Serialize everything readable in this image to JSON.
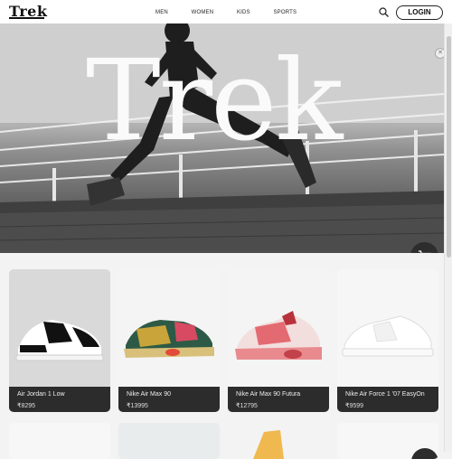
{
  "header": {
    "logo": "Trek",
    "menu": [
      "MEN",
      "WOMEN",
      "KIDS",
      "SPORTS"
    ],
    "login_label": "LOGIN"
  },
  "hero": {
    "title": "Trek"
  },
  "products": [
    {
      "name": "Air Jordan 1 Low",
      "price": "₹8295"
    },
    {
      "name": "Nike Air Max 90",
      "price": "₹13995"
    },
    {
      "name": "Nike Air Max 90 Futura",
      "price": "₹12795"
    },
    {
      "name": "Nike Air Force 1 '07 EasyOn",
      "price": "₹9599"
    }
  ],
  "icons": [
    "search-icon",
    "cart-icon",
    "close-icon"
  ]
}
